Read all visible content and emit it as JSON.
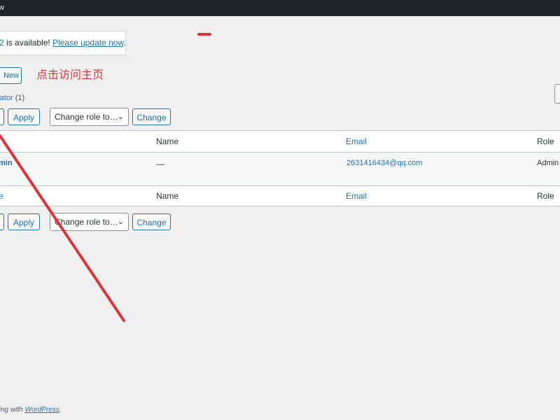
{
  "admin_bar": {
    "text": "w"
  },
  "notice": {
    "hidden_link": "2",
    "text": " is available! ",
    "link": "Please update now",
    "period": "."
  },
  "users": {
    "add_new_label": "New",
    "filter_label": "rator",
    "filter_count": "(1)"
  },
  "annotation": {
    "text": "点击访问主页"
  },
  "bulk_top": {
    "apply_label": "Apply",
    "role_select": "Change role to…",
    "change_label": "Change"
  },
  "bulk_bottom": {
    "apply_label": "Apply",
    "role_select": "Change role to…",
    "change_label": "Change"
  },
  "table": {
    "columns": {
      "name": "Name",
      "email": "Email",
      "role": "Role"
    },
    "footer_username": "e",
    "rows": [
      {
        "username": "min",
        "name": "—",
        "email": "2631416434@qq.com",
        "role": "Admin"
      }
    ]
  },
  "footer": {
    "prefix": "ting with ",
    "link": "WordPress",
    "suffix": "."
  },
  "colors": {
    "accent": "#2271b1",
    "annotation_red": "#d63638",
    "admin_bar": "#1d2327",
    "background": "#f0f0f1"
  }
}
